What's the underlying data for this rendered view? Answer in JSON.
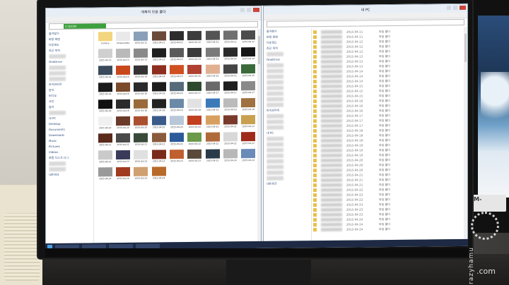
{
  "left_window": {
    "title": "개체의 모음 폴더",
    "address_segment": "C:\\DCIM",
    "nav_items": [
      "즐겨찾기",
      "바탕 화면",
      "다운로드",
      "최근 위치",
      "",
      "OneDrive",
      "",
      "",
      "",
      "라이브러리",
      "문서",
      "비디오",
      "사진",
      "음악",
      "",
      "내 PC",
      "Desktop",
      "Documents",
      "Downloads",
      "Music",
      "Pictures",
      "Videos",
      "로컬 디스크 (C:)",
      "",
      "",
      "네트워크"
    ],
    "thumbs": [
      {
        "cap": "Camera",
        "color": "#f2d57c"
      },
      {
        "cap": "Screenshots",
        "color": "#e9e9e9"
      },
      {
        "cap": "2015-04-11",
        "color": "#8aa0b8"
      },
      {
        "cap": "2015-04-11",
        "color": "#6b4a3a"
      },
      {
        "cap": "2015-04-12",
        "color": "#2c2c2c"
      },
      {
        "cap": "2015-04-12",
        "color": "#3d3d3d"
      },
      {
        "cap": "2015-04-12",
        "color": "#545454"
      },
      {
        "cap": "2015-04-12",
        "color": "#707070"
      },
      {
        "cap": "2015-04-12",
        "color": "#4c4c4c"
      },
      {
        "cap": "2015-04-13",
        "color": "#cfcfcf"
      },
      {
        "cap": "2015-04-13",
        "color": "#b9b9b9"
      },
      {
        "cap": "2015-04-13",
        "color": "#8a8a8a"
      },
      {
        "cap": "2015-04-13",
        "color": "#1f1f1f"
      },
      {
        "cap": "2015-04-13",
        "color": "#5a5a5a"
      },
      {
        "cap": "2015-04-13",
        "color": "#3a3a3a"
      },
      {
        "cap": "2015-04-13",
        "color": "#7a7a7a"
      },
      {
        "cap": "2015-04-14",
        "color": "#2a2a2a"
      },
      {
        "cap": "2015-04-14",
        "color": "#161616"
      },
      {
        "cap": "2015-04-14",
        "color": "#3a4a5a"
      },
      {
        "cap": "2015-04-14",
        "color": "#c8481c"
      },
      {
        "cap": "2015-04-14",
        "color": "#333333"
      },
      {
        "cap": "2015-04-14",
        "color": "#8d2e1e"
      },
      {
        "cap": "2015-04-15",
        "color": "#d05020"
      },
      {
        "cap": "2015-04-15",
        "color": "#b04030"
      },
      {
        "cap": "2015-04-15",
        "color": "#e0b090"
      },
      {
        "cap": "2015-04-15",
        "color": "#444444"
      },
      {
        "cap": "2015-04-15",
        "color": "#3a6a3a"
      },
      {
        "cap": "2015-04-16",
        "color": "#1a1a1a"
      },
      {
        "cap": "2015-04-16",
        "color": "#7a4a2a"
      },
      {
        "cap": "2015-04-16",
        "color": "#2a2a2a"
      },
      {
        "cap": "2015-04-16",
        "color": "#1c1c1c"
      },
      {
        "cap": "2015-04-16",
        "color": "#556b7a"
      },
      {
        "cap": "2015-04-17",
        "color": "#2e4a2e"
      },
      {
        "cap": "2015-04-17",
        "color": "#6a6a6a"
      },
      {
        "cap": "2015-04-17",
        "color": "#1e1e1e"
      },
      {
        "cap": "2015-04-17",
        "color": "#8a8a8a"
      },
      {
        "cap": "2015-04-18",
        "color": "#111111"
      },
      {
        "cap": "2015-04-18",
        "color": "#2b2b2b"
      },
      {
        "cap": "2015-04-18",
        "color": "#9a6a3a"
      },
      {
        "cap": "2015-04-18",
        "color": "#222222"
      },
      {
        "cap": "2015-04-19",
        "color": "#6a8aa8"
      },
      {
        "cap": "2015-04-19",
        "color": "#e2e2e2"
      },
      {
        "cap": "2015-04-19",
        "color": "#3a7ab8"
      },
      {
        "cap": "2015-04-19",
        "color": "#bbbbbb"
      },
      {
        "cap": "2015-04-19",
        "color": "#a07040"
      },
      {
        "cap": "2015-04-20",
        "color": "#f0f0f0"
      },
      {
        "cap": "2015-04-20",
        "color": "#6a3a2a"
      },
      {
        "cap": "2015-04-20",
        "color": "#aa5030"
      },
      {
        "cap": "2015-04-20",
        "color": "#3a5a8a"
      },
      {
        "cap": "2015-04-20",
        "color": "#b9c8d8"
      },
      {
        "cap": "2015-04-20",
        "color": "#c04020"
      },
      {
        "cap": "2015-04-20",
        "color": "#d8a060"
      },
      {
        "cap": "2015-04-21",
        "color": "#7a3a2a"
      },
      {
        "cap": "2015-04-21",
        "color": "#c8a050"
      },
      {
        "cap": "2015-04-21",
        "color": "#5a2a1a"
      },
      {
        "cap": "2015-04-21",
        "color": "#4a4a4a"
      },
      {
        "cap": "2015-04-21",
        "color": "#3a4a3a"
      },
      {
        "cap": "2015-04-21",
        "color": "#8a5a3a"
      },
      {
        "cap": "2015-04-22",
        "color": "#2a5a9a"
      },
      {
        "cap": "2015-04-22",
        "color": "#6a9a4a"
      },
      {
        "cap": "2015-04-22",
        "color": "#b06a3a"
      },
      {
        "cap": "2015-04-22",
        "color": "#d8d8d8"
      },
      {
        "cap": "2015-04-22",
        "color": "#a02a1a"
      },
      {
        "cap": "2015-04-22",
        "color": "#cacaca"
      },
      {
        "cap": "2015-04-23",
        "color": "#3a3a5a"
      },
      {
        "cap": "2015-04-23",
        "color": "#e0e0e0"
      },
      {
        "cap": "2015-04-23",
        "color": "#7a2a1a"
      },
      {
        "cap": "2015-04-23",
        "color": "#c06030"
      },
      {
        "cap": "2015-04-23",
        "color": "#5a4a3a"
      },
      {
        "cap": "2015-04-23",
        "color": "#2a3a4a"
      },
      {
        "cap": "2015-04-24",
        "color": "#b8b8b8"
      },
      {
        "cap": "2015-04-24",
        "color": "#6a8ab8"
      },
      {
        "cap": "2015-04-24",
        "color": "#9a9a9a"
      },
      {
        "cap": "2015-04-24",
        "color": "#a03a20"
      },
      {
        "cap": "2015-04-24",
        "color": "#d0a070"
      },
      {
        "cap": "2015-04-24",
        "color": "#b86a2a"
      }
    ]
  },
  "right_window": {
    "title": "내 PC",
    "nav_items": [
      "즐겨찾기",
      "바탕 화면",
      "다운로드",
      "최근 위치",
      "",
      "OneDrive",
      "",
      "",
      "",
      "",
      "",
      "",
      "",
      "",
      "라이브러리",
      "",
      "",
      "",
      "내 PC",
      "",
      "",
      "",
      "",
      "",
      "",
      "",
      "",
      "네트워크"
    ],
    "rows": [
      {
        "dt": "2015-04-11",
        "ty": "파일 폴더"
      },
      {
        "dt": "2015-04-11",
        "ty": "파일 폴더"
      },
      {
        "dt": "2015-04-12",
        "ty": "파일 폴더"
      },
      {
        "dt": "2015-04-12",
        "ty": "파일 폴더"
      },
      {
        "dt": "2015-04-12",
        "ty": "파일 폴더"
      },
      {
        "dt": "2015-04-13",
        "ty": "파일 폴더"
      },
      {
        "dt": "2015-04-13",
        "ty": "파일 폴더"
      },
      {
        "dt": "2015-04-13",
        "ty": "파일 폴더"
      },
      {
        "dt": "2015-04-14",
        "ty": "파일 폴더"
      },
      {
        "dt": "2015-04-14",
        "ty": "파일 폴더"
      },
      {
        "dt": "2015-04-14",
        "ty": "파일 폴더"
      },
      {
        "dt": "2015-04-15",
        "ty": "파일 폴더"
      },
      {
        "dt": "2015-04-15",
        "ty": "파일 폴더"
      },
      {
        "dt": "2015-04-15",
        "ty": "파일 폴더"
      },
      {
        "dt": "2015-04-16",
        "ty": "파일 폴더"
      },
      {
        "dt": "2015-04-16",
        "ty": "파일 폴더"
      },
      {
        "dt": "2015-04-16",
        "ty": "파일 폴더"
      },
      {
        "dt": "2015-04-17",
        "ty": "파일 폴더"
      },
      {
        "dt": "2015-04-17",
        "ty": "파일 폴더"
      },
      {
        "dt": "2015-04-17",
        "ty": "파일 폴더"
      },
      {
        "dt": "2015-04-18",
        "ty": "파일 폴더"
      },
      {
        "dt": "2015-04-18",
        "ty": "파일 폴더"
      },
      {
        "dt": "2015-04-18",
        "ty": "파일 폴더"
      },
      {
        "dt": "2015-04-19",
        "ty": "파일 폴더"
      },
      {
        "dt": "2015-04-19",
        "ty": "파일 폴더"
      },
      {
        "dt": "2015-04-19",
        "ty": "파일 폴더"
      },
      {
        "dt": "2015-04-20",
        "ty": "파일 폴더"
      },
      {
        "dt": "2015-04-20",
        "ty": "파일 폴더"
      },
      {
        "dt": "2015-04-20",
        "ty": "파일 폴더"
      },
      {
        "dt": "2015-04-21",
        "ty": "파일 폴더"
      },
      {
        "dt": "2015-04-21",
        "ty": "파일 폴더"
      },
      {
        "dt": "2015-04-21",
        "ty": "파일 폴더"
      },
      {
        "dt": "2015-04-22",
        "ty": "파일 폴더"
      },
      {
        "dt": "2015-04-22",
        "ty": "파일 폴더"
      },
      {
        "dt": "2015-04-22",
        "ty": "파일 폴더"
      },
      {
        "dt": "2015-04-23",
        "ty": "파일 폴더"
      },
      {
        "dt": "2015-04-23",
        "ty": "파일 폴더"
      },
      {
        "dt": "2015-04-23",
        "ty": "파일 폴더"
      },
      {
        "dt": "2015-04-24",
        "ty": "파일 폴더"
      },
      {
        "dt": "2015-04-24",
        "ty": "파일 폴더"
      },
      {
        "dt": "2015-04-24",
        "ty": "파일 폴더"
      }
    ]
  },
  "taskbar": {
    "items": [
      "",
      "",
      "",
      ""
    ],
    "tray": ""
  },
  "sticker": {
    "label": "M-"
  },
  "watermark": {
    "brand": "Crazyhamu",
    "suffix": ".com"
  },
  "colors": {
    "folder": "#e8c04a",
    "accent_green": "#3d9f3d",
    "taskbar": "#1e2a44",
    "close": "#c9453a"
  }
}
